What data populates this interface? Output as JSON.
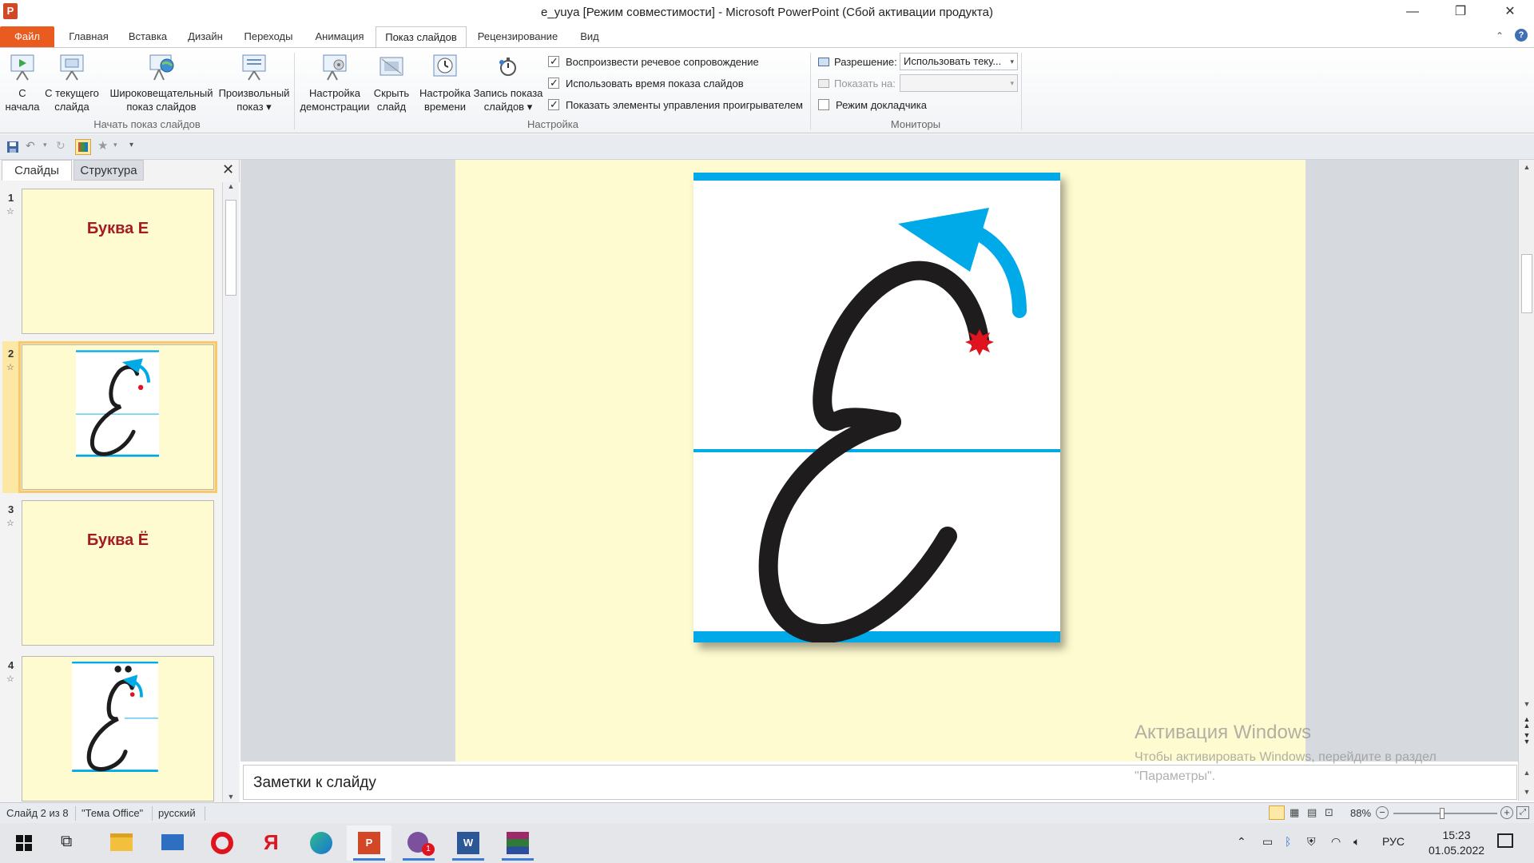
{
  "window": {
    "title": "e_yuya [Режим совместимости]  -  Microsoft PowerPoint (Сбой активации продукта)",
    "app_icon_letter": "P"
  },
  "ribbon_tabs": [
    "Файл",
    "Главная",
    "Вставка",
    "Дизайн",
    "Переходы",
    "Анимация",
    "Показ слайдов",
    "Рецензирование",
    "Вид"
  ],
  "ribbon": {
    "group1": {
      "label": "Начать показ слайдов",
      "buttons": [
        {
          "line1": "С",
          "line2": "начала"
        },
        {
          "line1": "С текущего",
          "line2": "слайда"
        },
        {
          "line1": "Широковещательный",
          "line2": "показ слайдов"
        },
        {
          "line1": "Произвольный",
          "line2": "показ ▾"
        }
      ]
    },
    "group2": {
      "label": "Настройка",
      "buttons": [
        {
          "line1": "Настройка",
          "line2": "демонстрации"
        },
        {
          "line1": "Скрыть",
          "line2": "слайд"
        },
        {
          "line1": "Настройка",
          "line2": "времени"
        },
        {
          "line1": "Запись показа",
          "line2": "слайдов ▾"
        }
      ],
      "checkboxes": [
        {
          "label": "Воспроизвести речевое сопровождение",
          "checked": true
        },
        {
          "label": "Использовать время показа слайдов",
          "checked": true
        },
        {
          "label": "Показать элементы управления проигрывателем",
          "checked": true
        }
      ]
    },
    "group3": {
      "label": "Мониторы",
      "resolution_label": "Разрешение:",
      "resolution_value": "Использовать теку...",
      "show_on_label": "Показать на:",
      "show_on_value": "",
      "presenter_label": "Режим докладчика",
      "presenter_checked": false
    }
  },
  "panel": {
    "tabs": [
      "Слайды",
      "Структура"
    ],
    "slides": [
      {
        "num": "1",
        "title": "Буква  Е"
      },
      {
        "num": "2",
        "title": ""
      },
      {
        "num": "3",
        "title": "Буква  Ё"
      },
      {
        "num": "4",
        "title": ""
      }
    ]
  },
  "notes_placeholder": "Заметки к слайду",
  "watermark": {
    "line1": "Активация Windows",
    "line2": "Чтобы активировать Windows, перейдите в раздел",
    "line3": "\"Параметры\"."
  },
  "status": {
    "slide_info": "Слайд 2 из 8",
    "theme": "\"Тема Office\"",
    "language": "русский",
    "zoom": "88%"
  },
  "taskbar": {
    "lang": "РУС",
    "time": "15:23",
    "date": "01.05.2022",
    "badge": "1"
  },
  "colors": {
    "file_tab": "#e95b1e",
    "slide_bg": "#fffbd0",
    "guide_blue": "#00a9e8",
    "letter_black": "#1e1c1c",
    "start_red": "#e0141e"
  }
}
